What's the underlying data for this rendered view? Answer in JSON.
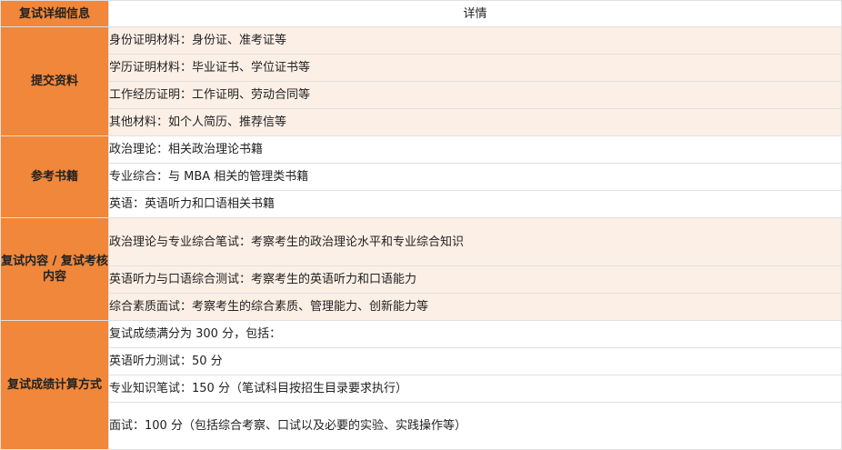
{
  "header": {
    "left": "复试详细信息",
    "right": "详情"
  },
  "sections": [
    {
      "category": "提交资料",
      "items": [
        "身份证明材料：身份证、准考证等",
        "学历证明材料：毕业证书、学位证书等",
        "工作经历证明：工作证明、劳动合同等",
        "其他材料：如个人简历、推荐信等"
      ]
    },
    {
      "category": "参考书籍",
      "items": [
        "政治理论：相关政治理论书籍",
        "专业综合：与 MBA 相关的管理类书籍",
        "英语：英语听力和口语相关书籍"
      ]
    },
    {
      "category": "复试内容 / 复试考核内容",
      "items": [
        "政治理论与专业综合笔试：考察考生的政治理论水平和专业综合知识",
        "英语听力与口语综合测试：考察考生的英语听力和口语能力",
        "综合素质面试：考察考生的综合素质、管理能力、创新能力等"
      ]
    },
    {
      "category": "复试成绩计算方式",
      "items": [
        "复试成绩满分为 300 分，包括：",
        "英语听力测试：50 分",
        "专业知识笔试：150 分（笔试科目按招生目录要求执行）",
        "面试：100 分（包括综合考察、口试以及必要的实验、实践操作等）"
      ]
    }
  ],
  "colors": {
    "accent": "#f0873a",
    "shade_row": "#fcefe6"
  }
}
